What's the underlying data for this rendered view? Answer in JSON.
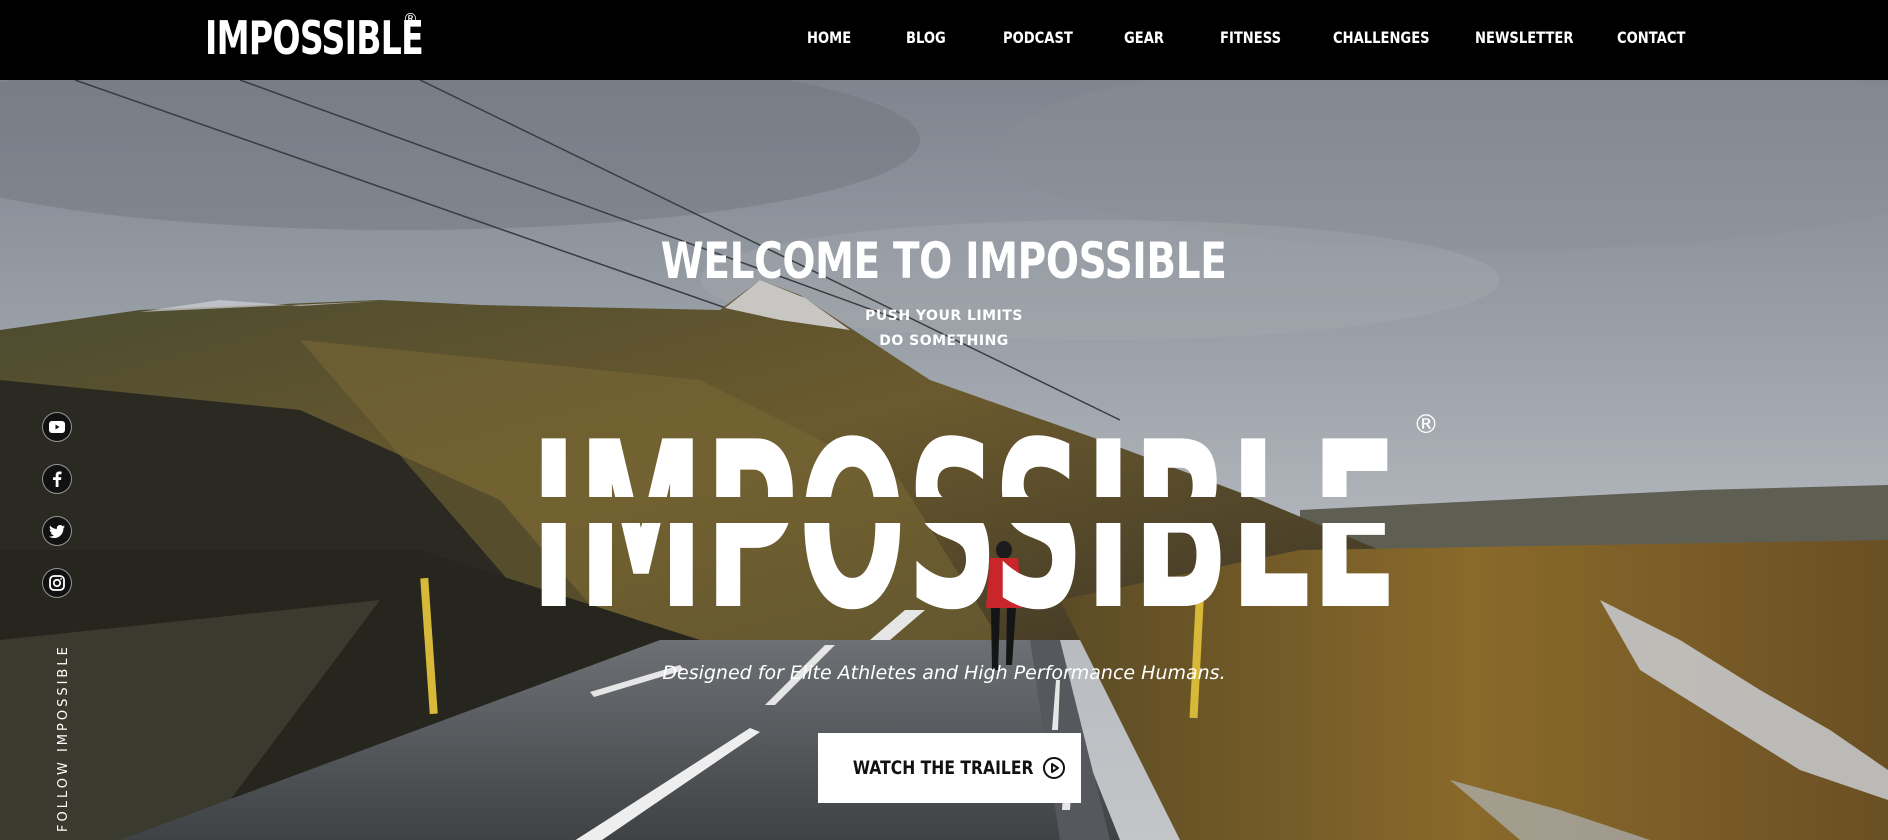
{
  "header": {
    "logo": "IMPOSSIBLE",
    "logo_mark": "®",
    "nav": [
      {
        "label": "HOME"
      },
      {
        "label": "BLOG"
      },
      {
        "label": "PODCAST"
      },
      {
        "label": "GEAR"
      },
      {
        "label": "FITNESS"
      },
      {
        "label": "CHALLENGES"
      },
      {
        "label": "NEWSLETTER"
      },
      {
        "label": "CONTACT"
      }
    ]
  },
  "hero": {
    "title": "WELCOME TO IMPOSSIBLE",
    "tagline_1": "PUSH YOUR LIMITS",
    "tagline_2": "DO SOMETHING",
    "big_word": "IMPOSSIBLE",
    "big_word_mark": "®",
    "subline": "Designed for Elite Athletes and High Performance Humans.",
    "cta_label": "WATCH THE TRAILER"
  },
  "social": {
    "follow_label": "FOLLOW IMPOSSIBLE",
    "icons": [
      "youtube-icon",
      "facebook-icon",
      "twitter-icon",
      "instagram-icon"
    ]
  },
  "colors": {
    "header_bg": "#000000",
    "button_bg": "#ffffff",
    "button_text": "#111111"
  }
}
